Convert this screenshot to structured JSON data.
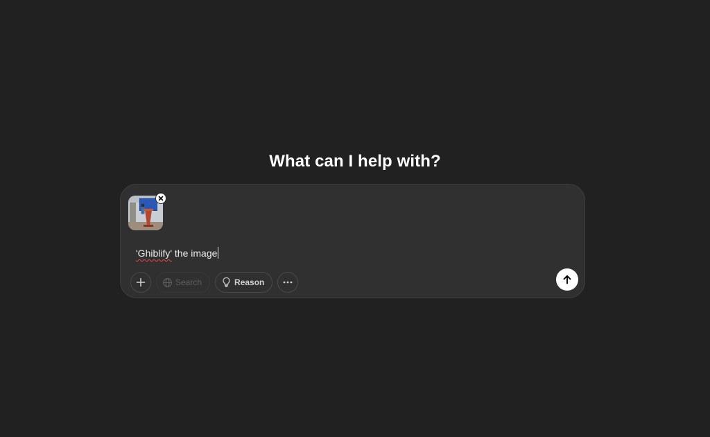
{
  "main": {
    "heading": "What can I help with?"
  },
  "composer": {
    "attachment": {
      "type": "image",
      "remove_icon": "close-icon"
    },
    "prompt": {
      "misspelled_word": "'Ghiblify'",
      "rest": " the image"
    },
    "toolbar": {
      "add_icon": "plus-icon",
      "search_label": "Search",
      "search_icon": "globe-icon",
      "search_enabled": false,
      "reason_label": "Reason",
      "reason_icon": "lightbulb-icon",
      "more_icon": "ellipsis-icon"
    },
    "send_icon": "arrow-up-icon"
  },
  "colors": {
    "background": "#212121",
    "composer_bg": "#303030",
    "text": "#ececec",
    "send_button": "#ffffff",
    "spellcheck_underline": "#e5484d"
  }
}
